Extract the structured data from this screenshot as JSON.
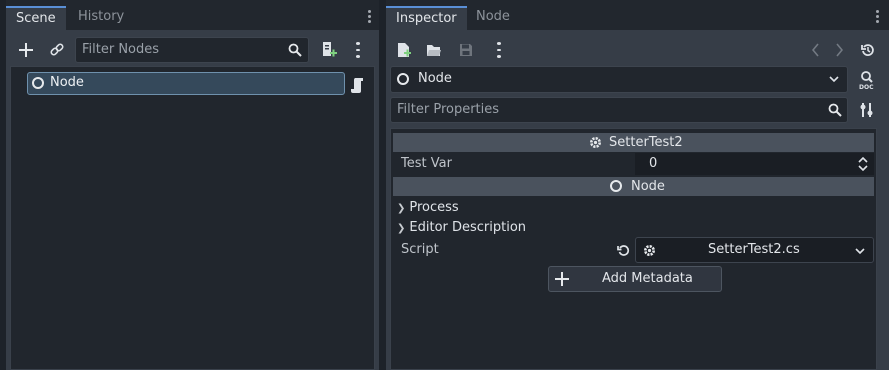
{
  "scene_dock": {
    "tabs": [
      {
        "label": "Scene",
        "active": true
      },
      {
        "label": "History",
        "active": false
      }
    ],
    "toolbar": {
      "add_icon": "plus-icon",
      "link_icon": "link-icon",
      "filter_placeholder": "Filter Nodes",
      "search_icon": "search-icon",
      "attach_script_icon": "add-script-icon",
      "menu_icon": "kebab-menu-icon"
    },
    "tree": {
      "nodes": [
        {
          "label": "Node",
          "icon": "node-circle-icon",
          "selected": true,
          "badge_icon": "script-scroll-icon"
        }
      ]
    }
  },
  "inspector_dock": {
    "tabs": [
      {
        "label": "Inspector",
        "active": true
      },
      {
        "label": "Node",
        "active": false
      }
    ],
    "toolbar": {
      "new_resource_icon": "new-resource-icon",
      "open_icon": "folder-open-icon",
      "save_icon": "save-icon",
      "menu_icon": "kebab-menu-icon",
      "back_icon": "chevron-left-icon",
      "forward_icon": "chevron-right-icon",
      "history_icon": "history-icon"
    },
    "object_selector": {
      "label": "Node",
      "doc_icon": "doc-icon"
    },
    "filter": {
      "placeholder": "Filter Properties",
      "tools_icon": "tools-icon"
    },
    "sections": [
      {
        "title": "SetterTest2",
        "icon": "gear-script-icon",
        "properties": [
          {
            "label": "Test Var",
            "value": "0",
            "editor": "spinbox"
          }
        ]
      },
      {
        "title": "Node",
        "icon": "node-circle-icon",
        "groups": [
          {
            "label": "Process",
            "expanded": false
          },
          {
            "label": "Editor Description",
            "expanded": false
          }
        ],
        "properties": [
          {
            "label": "Script",
            "value": "SetterTest2.cs",
            "editor": "resource"
          }
        ]
      }
    ],
    "add_metadata_label": "Add Metadata"
  },
  "colors": {
    "accent": "#5a8fd6",
    "panel": "#363d47",
    "field": "#21262d",
    "selected_row": "#35495b"
  }
}
